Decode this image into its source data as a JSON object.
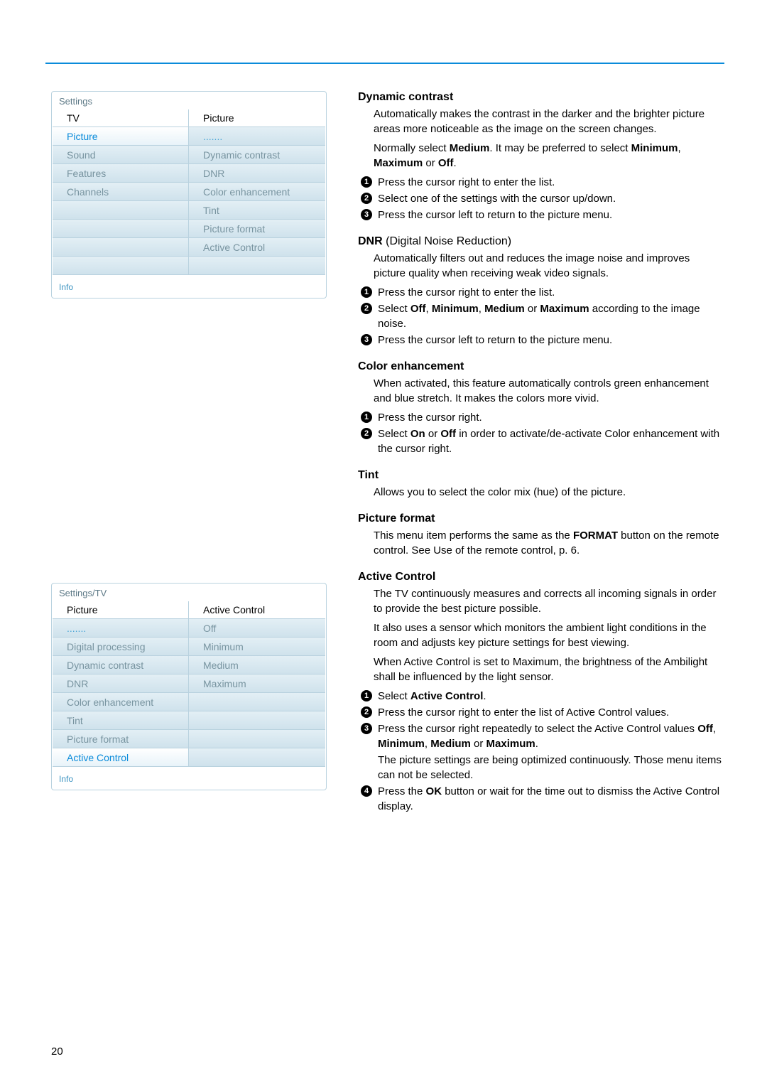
{
  "page_number": "20",
  "panel1": {
    "title": "Settings",
    "footer": "Info",
    "left_head": "TV",
    "right_head": "Picture",
    "left_items": [
      "Picture",
      "Sound",
      "Features",
      "Channels",
      "",
      "",
      "",
      ""
    ],
    "left_selected_index": 0,
    "right_items": [
      ".......",
      "Dynamic contrast",
      "DNR",
      "Color enhancement",
      "Tint",
      "Picture format",
      "Active Control",
      ""
    ]
  },
  "panel2": {
    "title": "Settings/TV",
    "footer": "Info",
    "left_head": "Picture",
    "right_head": "Active Control",
    "left_items": [
      ".......",
      "Digital processing",
      "Dynamic contrast",
      "DNR",
      "Color enhancement",
      "Tint",
      "Picture format",
      "Active Control"
    ],
    "left_selected_index": 7,
    "right_items": [
      "Off",
      "Minimum",
      "Medium",
      "Maximum",
      "",
      "",
      "",
      ""
    ]
  },
  "sections": {
    "dynamic_contrast": {
      "title": "Dynamic contrast",
      "body_line1": "Automatically makes the contrast in the darker and the brighter picture areas more noticeable as the image on the screen changes.",
      "body_line2a": "Normally select ",
      "body_line2b": "Medium",
      "body_line2c": ". It may be preferred to select ",
      "body_line2d": "Minimum",
      "body_line2e": ", ",
      "body_line2f": "Maximum",
      "body_line2g": " or ",
      "body_line2h": "Off",
      "body_line2i": ".",
      "step1": "Press the cursor right to enter the list.",
      "step2": "Select one of the settings with the cursor up/down.",
      "step3": "Press the cursor left to return to the picture menu."
    },
    "dnr": {
      "title_a": "DNR ",
      "title_b": "(Digital Noise Reduction)",
      "body": "Automatically filters out and reduces the image noise and improves picture quality when receiving weak video signals.",
      "step1": "Press the cursor right to enter the list.",
      "step2_a": "Select ",
      "step2_b": "Off",
      "step2_c": ", ",
      "step2_d": "Minimum",
      "step2_e": ", ",
      "step2_f": "Medium",
      "step2_g": " or ",
      "step2_h": "Maximum",
      "step2_i": " according to the image noise.",
      "step3": "Press the cursor left to return to the picture menu."
    },
    "color_enhancement": {
      "title": "Color enhancement",
      "body": "When activated, this feature automatically controls green enhancement and blue stretch. It makes the colors more vivid.",
      "step1": "Press the cursor right.",
      "step2_a": "Select ",
      "step2_b": "On",
      "step2_c": " or ",
      "step2_d": "Off",
      "step2_e": " in order to activate/de-activate Color enhancement with the cursor right."
    },
    "tint": {
      "title": "Tint",
      "body": "Allows you to select the color mix (hue) of the picture."
    },
    "picture_format": {
      "title": "Picture format",
      "body_a": "This menu item performs the same as the ",
      "body_b": "FORMAT",
      "body_c": " button on the remote control. See Use of the remote control, p. 6."
    },
    "active_control": {
      "title": "Active Control",
      "body1": "The TV continuously measures and corrects all incoming signals in order to provide the best picture possible.",
      "body2": "It also uses a sensor which monitors the ambient light conditions in the room and adjusts key picture settings for best viewing.",
      "body3": "When Active Control is set to Maximum, the brightness of the Ambilight shall be influenced by the light sensor.",
      "step1_a": "Select ",
      "step1_b": "Active Control",
      "step1_c": ".",
      "step2": "Press the cursor right to enter the list of Active Control values.",
      "step3_a": "Press the cursor right repeatedly to select the Active Control values ",
      "step3_b": "Off",
      "step3_c": ", ",
      "step3_d": "Minimum",
      "step3_e": ", ",
      "step3_f": "Medium",
      "step3_g": " or ",
      "step3_h": "Maximum",
      "step3_i": ".",
      "step3_note": "The picture settings are being optimized continuously. Those menu items can not be selected.",
      "step4_a": "Press the ",
      "step4_b": "OK",
      "step4_c": " button or wait for the time out to dismiss the Active Control display."
    }
  }
}
